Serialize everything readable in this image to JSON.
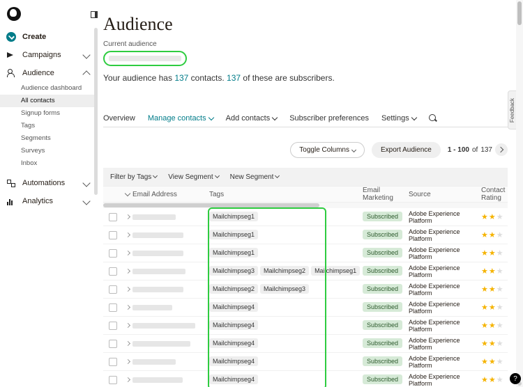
{
  "sidebar": {
    "create": "Create",
    "campaigns": "Campaigns",
    "audience": "Audience",
    "subs": [
      "Audience dashboard",
      "All contacts",
      "Signup forms",
      "Tags",
      "Segments",
      "Surveys",
      "Inbox"
    ],
    "automations": "Automations",
    "analytics": "Analytics"
  },
  "page": {
    "title": "Audience",
    "current_label": "Current audience",
    "sub_a": "Your audience has ",
    "sub_n1": "137",
    "sub_b": " contacts. ",
    "sub_n2": "137",
    "sub_c": " of these are subscribers."
  },
  "tabs": {
    "overview": "Overview",
    "manage": "Manage contacts",
    "add": "Add contacts",
    "prefs": "Subscriber preferences",
    "settings": "Settings"
  },
  "toolbar": {
    "toggle": "Toggle Columns",
    "export": "Export Audience",
    "range": "1 - 100",
    "of": " of ",
    "total": "137"
  },
  "filters": {
    "tags": "Filter by Tags",
    "view": "View Segment",
    "new": "New Segment"
  },
  "cols": {
    "email": "Email Address",
    "tags": "Tags",
    "mkt": "Email Marketing",
    "src": "Source",
    "rate": "Contact Rating"
  },
  "status": "Subscribed",
  "source": "Adobe Experience Platform",
  "rows": [
    {
      "tags": [
        "Mailchimpseg1"
      ],
      "stars": 2
    },
    {
      "tags": [
        "Mailchimpseg1"
      ],
      "stars": 2
    },
    {
      "tags": [
        "Mailchimpseg1"
      ],
      "stars": 2
    },
    {
      "tags": [
        "Mailchimpseg3",
        "Mailchimpseg2",
        "Mailchimpseg1"
      ],
      "stars": 2
    },
    {
      "tags": [
        "Mailchimpseg2",
        "Mailchimpseg3"
      ],
      "stars": 2
    },
    {
      "tags": [
        "Mailchimpseg4"
      ],
      "stars": 2
    },
    {
      "tags": [
        "Mailchimpseg4"
      ],
      "stars": 2
    },
    {
      "tags": [
        "Mailchimpseg4"
      ],
      "stars": 2
    },
    {
      "tags": [
        "Mailchimpseg4"
      ],
      "stars": 2
    },
    {
      "tags": [
        "Mailchimpseg4"
      ],
      "stars": 2
    }
  ],
  "feedback": "Feedback",
  "help": "?"
}
